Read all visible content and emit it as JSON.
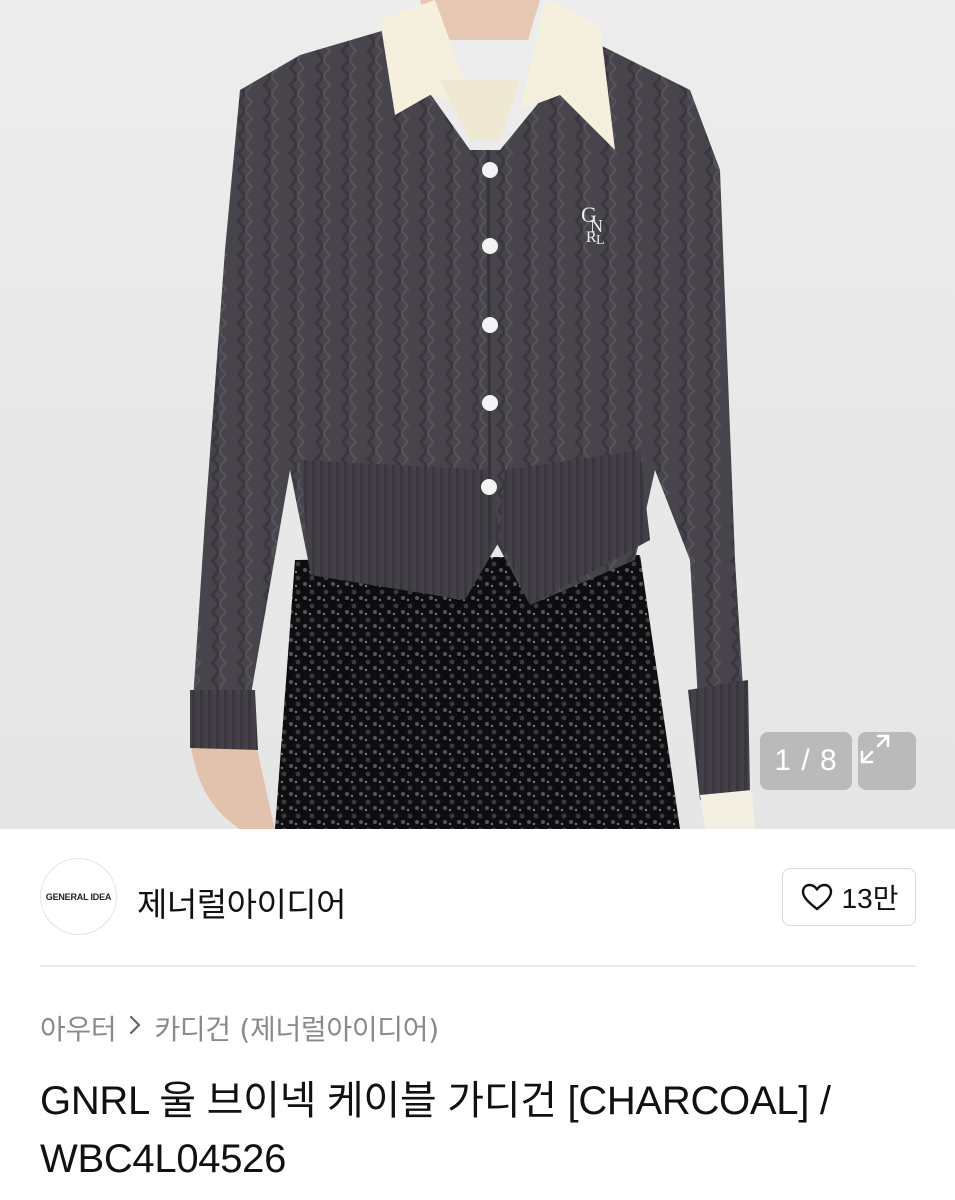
{
  "gallery": {
    "counter": "1 / 8",
    "current": 1,
    "total": 8,
    "expand_icon": "expand-arrows-icon"
  },
  "brand": {
    "logo_text": "GENERAL IDEA",
    "name": "제너럴아이디어",
    "like_icon": "heart-outline-icon",
    "like_count": "13만"
  },
  "breadcrumb": {
    "items": [
      "아우터",
      "카디건 (제너럴아이디어)"
    ],
    "separator_icon": "chevron-right-icon"
  },
  "product": {
    "title": "GNRL 울 브이넥 케이블 가디건 [CHARCOAL] / WBC4L04526"
  },
  "colors": {
    "background": "#ffffff",
    "text": "#111111",
    "muted": "#8a8a8a",
    "border": "#d9d9d9",
    "cardigan": "#46434a"
  }
}
